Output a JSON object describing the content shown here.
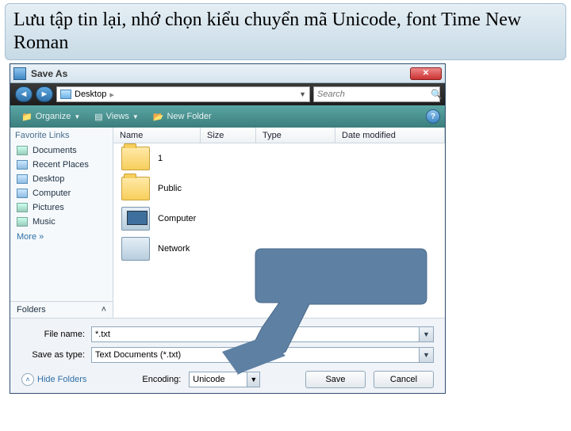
{
  "caption": "Lưu tập tin lại, nhớ chọn kiểu chuyển mã Unicode, font Time New Roman",
  "dialog": {
    "title": "Save As",
    "breadcrumb": "Desktop",
    "search_placeholder": "Search",
    "toolbar": {
      "organize": "Organize",
      "views": "Views",
      "new_folder": "New Folder"
    },
    "sidebar": {
      "header": "Favorite Links",
      "items": [
        "Documents",
        "Recent Places",
        "Desktop",
        "Computer",
        "Pictures",
        "Music"
      ],
      "more": "More  »",
      "folders": "Folders"
    },
    "columns": {
      "name": "Name",
      "size": "Size",
      "type": "Type",
      "date": "Date modified"
    },
    "files": [
      {
        "label": "1",
        "kind": "folder"
      },
      {
        "label": "Public",
        "kind": "folder"
      },
      {
        "label": "Computer",
        "kind": "computer"
      },
      {
        "label": "Network",
        "kind": "network"
      }
    ],
    "filename_label": "File name:",
    "filename_value": "*.txt",
    "savetype_label": "Save as type:",
    "savetype_value": "Text Documents (*.txt)",
    "hide_folders": "Hide Folders",
    "encoding_label": "Encoding:",
    "encoding_value": "Unicode",
    "save": "Save",
    "cancel": "Cancel"
  }
}
